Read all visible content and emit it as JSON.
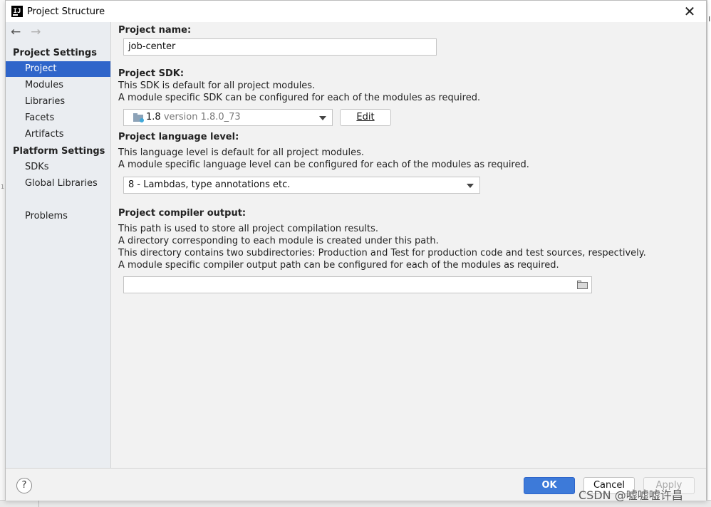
{
  "background": {
    "fragment_right": "Il",
    "line_mark": "1"
  },
  "window": {
    "title": "Project Structure",
    "close_glyph": "✕",
    "icon_letters": "IJ"
  },
  "sidebar": {
    "back_glyph": "←",
    "forward_glyph": "→",
    "project_settings_header": "Project Settings",
    "project_settings_items": [
      {
        "label": "Project",
        "selected": true
      },
      {
        "label": "Modules"
      },
      {
        "label": "Libraries"
      },
      {
        "label": "Facets"
      },
      {
        "label": "Artifacts"
      }
    ],
    "platform_settings_header": "Platform Settings",
    "platform_settings_items": [
      {
        "label": "SDKs"
      },
      {
        "label": "Global Libraries"
      }
    ],
    "problems_label": "Problems"
  },
  "main": {
    "project_name": {
      "label": "Project name:",
      "value": "job-center"
    },
    "sdk": {
      "label": "Project SDK:",
      "desc1": "This SDK is default for all project modules.",
      "desc2": "A module specific SDK can be configured for each of the modules as required.",
      "selected_version": "1.8",
      "selected_detail": "version 1.8.0_73",
      "edit_button": "Edit"
    },
    "language_level": {
      "label": "Project language level:",
      "desc1": "This language level is default for all project modules.",
      "desc2": "A module specific language level can be configured for each of the modules as required.",
      "selected": "8 - Lambdas, type annotations etc."
    },
    "compiler_output": {
      "label": "Project compiler output:",
      "desc1": "This path is used to store all project compilation results.",
      "desc2": "A directory corresponding to each module is created under this path.",
      "desc3": "This directory contains two subdirectories: Production and Test for production code and test sources, respectively.",
      "desc4": "A module specific compiler output path can be configured for each of the modules as required.",
      "value": ""
    }
  },
  "footer": {
    "help": "?",
    "ok": "OK",
    "cancel": "Cancel",
    "apply": "Apply"
  },
  "watermark": "CSDN @嘘嘘嘘许昌",
  "colors": {
    "accent": "#2f65ca",
    "ok_button": "#3d7ad9",
    "sidebar_bg": "#eaedf1"
  }
}
